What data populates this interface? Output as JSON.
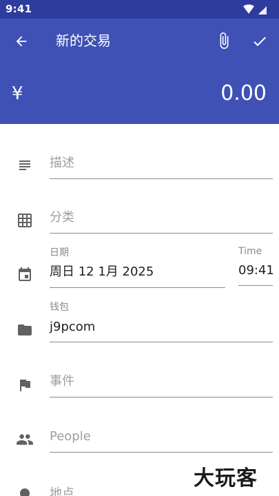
{
  "status_bar": {
    "time": "9:41"
  },
  "app_bar": {
    "title": "新的交易",
    "currency_symbol": "¥",
    "amount": "0.00",
    "background_color": "#3f51b5",
    "status_color": "#2e3c9e"
  },
  "form": {
    "description": {
      "placeholder": "描述"
    },
    "category": {
      "placeholder": "分类"
    },
    "date": {
      "label": "日期",
      "value": "周日 12 1月 2025"
    },
    "time": {
      "label": "Time",
      "value": "09:41"
    },
    "wallet": {
      "label": "钱包",
      "value": "j9pcom"
    },
    "event": {
      "placeholder": "事件"
    },
    "people": {
      "placeholder": "People"
    },
    "place": {
      "placeholder": "地点"
    }
  },
  "watermark": "大玩客",
  "icons": {
    "back": "arrow-back-icon",
    "attach": "paperclip-icon",
    "confirm": "check-icon",
    "description": "notes-icon",
    "category": "grid-icon",
    "date": "calendar-icon",
    "wallet": "folder-icon",
    "event": "flag-icon",
    "people": "people-icon",
    "place": "location-pin-icon"
  }
}
